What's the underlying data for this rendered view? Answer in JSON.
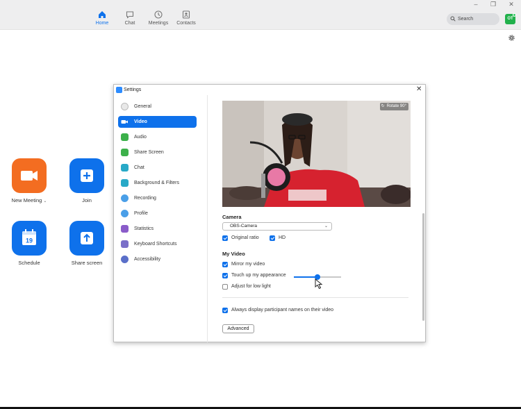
{
  "window": {
    "minimize": "–",
    "restore": "❐",
    "close": "✕"
  },
  "nav": [
    {
      "label": "Home",
      "icon": "home-icon",
      "active": true
    },
    {
      "label": "Chat",
      "icon": "chat-icon",
      "active": false
    },
    {
      "label": "Meetings",
      "icon": "clock-icon",
      "active": false
    },
    {
      "label": "Contacts",
      "icon": "contacts-icon",
      "active": false
    }
  ],
  "search": {
    "placeholder": "Search"
  },
  "avatar": {
    "initials": "OT"
  },
  "home_tiles": [
    {
      "label": "New Meeting",
      "has_dropdown": true,
      "icon": "video-camera-icon",
      "color": "#f36d21"
    },
    {
      "label": "Join",
      "icon": "plus-icon",
      "color": "#0e71eb"
    },
    {
      "label": "Schedule",
      "icon": "calendar-icon",
      "calendar_day": "19",
      "color": "#0e71eb"
    },
    {
      "label": "Share screen",
      "icon": "share-up-arrow-icon",
      "color": "#0e71eb"
    }
  ],
  "settings": {
    "title": "Settings",
    "close": "✕",
    "sidebar": [
      {
        "label": "General",
        "icon": "gear-icon",
        "color": "#9a9a9a"
      },
      {
        "label": "Video",
        "icon": "video-icon",
        "color": "#0e71eb",
        "active": true
      },
      {
        "label": "Audio",
        "icon": "headphones-icon",
        "color": "#3cb04a"
      },
      {
        "label": "Share Screen",
        "icon": "share-screen-icon",
        "color": "#3cb04a"
      },
      {
        "label": "Chat",
        "icon": "chat-bubble-icon",
        "color": "#28a9c7"
      },
      {
        "label": "Background & Filters",
        "icon": "background-icon",
        "color": "#28a9c7"
      },
      {
        "label": "Recording",
        "icon": "record-icon",
        "color": "#4a9fe8"
      },
      {
        "label": "Profile",
        "icon": "profile-icon",
        "color": "#4a9fe8"
      },
      {
        "label": "Statistics",
        "icon": "statistics-icon",
        "color": "#8a5cc9"
      },
      {
        "label": "Keyboard Shortcuts",
        "icon": "keyboard-icon",
        "color": "#7a6fc9"
      },
      {
        "label": "Accessibility",
        "icon": "accessibility-icon",
        "color": "#5a6fc9"
      }
    ],
    "video": {
      "rotate_label": "Rotate 90°",
      "camera_heading": "Camera",
      "camera_selected": "OBS-Camera",
      "original_ratio": {
        "label": "Original ratio",
        "checked": true
      },
      "hd": {
        "label": "HD",
        "checked": true
      },
      "my_video_heading": "My Video",
      "mirror": {
        "label": "Mirror my video",
        "checked": true
      },
      "touch_up": {
        "label": "Touch up my appearance",
        "checked": true,
        "level": 0.5
      },
      "low_light": {
        "label": "Adjust for low light",
        "checked": false
      },
      "display_names": {
        "label": "Always display participant names on their video",
        "checked": true
      },
      "advanced_label": "Advanced"
    }
  }
}
